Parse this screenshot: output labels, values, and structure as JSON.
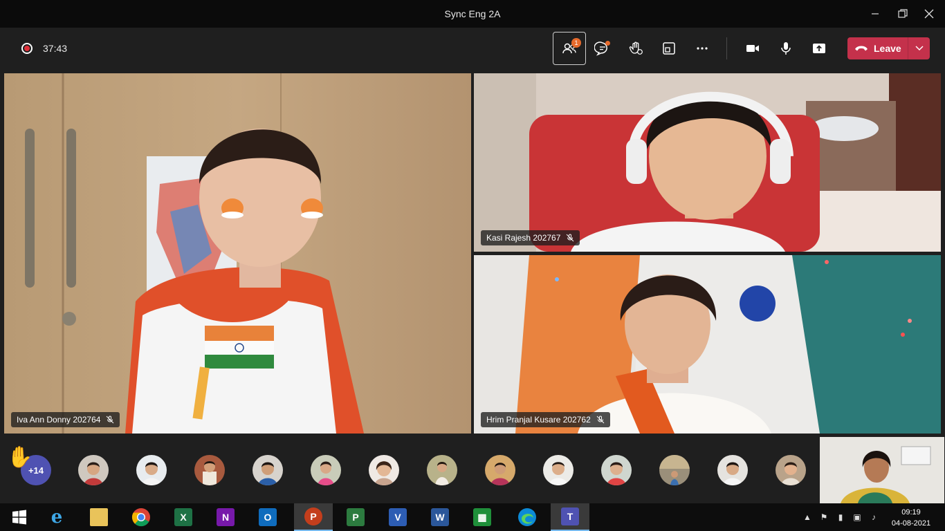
{
  "window": {
    "title": "Sync Eng 2A",
    "minimize_icon": "minimize-icon",
    "maximize_icon": "restore-icon",
    "close_icon": "close-icon"
  },
  "meeting": {
    "elapsed": "37:43",
    "recording_icon": "recording-icon",
    "participants_badge": "1",
    "leave_label": "Leave"
  },
  "controls": [
    {
      "name": "participants-button",
      "icon": "people-icon",
      "active": true
    },
    {
      "name": "chat-button",
      "icon": "chat-icon"
    },
    {
      "name": "reactions-button",
      "icon": "raise-hand-icon"
    },
    {
      "name": "rooms-button",
      "icon": "breakout-rooms-icon"
    },
    {
      "name": "more-actions-button",
      "icon": "more-icon"
    },
    {
      "name": "camera-button",
      "icon": "camera-icon"
    },
    {
      "name": "mic-button",
      "icon": "mic-icon"
    },
    {
      "name": "share-button",
      "icon": "share-icon"
    }
  ],
  "tiles": {
    "main": {
      "name": "Iva Ann Donny 202764"
    },
    "top_right": {
      "name": "Kasi Rajesh 202767"
    },
    "bottom_right": {
      "name": "Hrim Pranjal Kusare 202762"
    }
  },
  "strip": {
    "overflow_count": "+14",
    "raised_hand_icon": "raised-hand-icon"
  },
  "taskbar": {
    "apps": [
      "windows-start",
      "internet-explorer",
      "file-explorer",
      "chrome",
      "excel",
      "onenote",
      "outlook",
      "powerpoint",
      "project",
      "visio",
      "word",
      "project-grid",
      "edge",
      "teams"
    ],
    "time": "09:19",
    "date": "04-08-2021"
  },
  "colors": {
    "leave_red": "#c4314b",
    "teams_purple": "#4f52b2",
    "badge_orange": "#e66a2c"
  }
}
